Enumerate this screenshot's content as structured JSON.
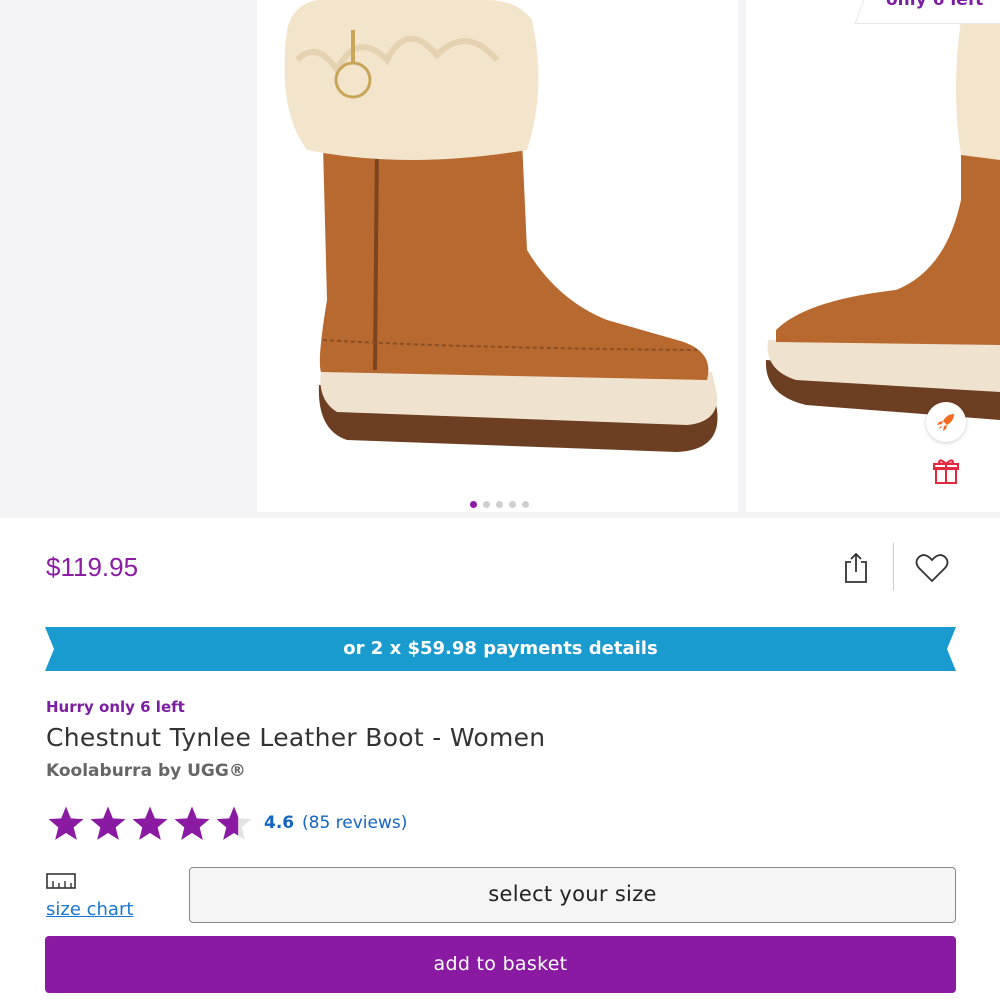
{
  "gallery": {
    "stock_ribbon": "only 6 left",
    "dots_count": 5,
    "active_dot": 0,
    "icons": [
      "rocket-icon",
      "gift-icon"
    ]
  },
  "product": {
    "price": "$119.95",
    "payment_banner": "or 2 x $59.98 payments details",
    "hurry": "Hurry only 6 left",
    "title": "Chestnut Tynlee Leather Boot - Women",
    "brand": "Koolaburra by UGG®",
    "rating": "4.6",
    "rating_value": 4.6,
    "reviews": "(85 reviews)"
  },
  "actions": {
    "size_chart": "size chart",
    "select_size": "select your size",
    "add_to_basket": "add to basket"
  },
  "colors": {
    "brand_purple": "#8a1aa1",
    "banner_blue": "#1a9bd0",
    "link_blue": "#1565c0"
  }
}
